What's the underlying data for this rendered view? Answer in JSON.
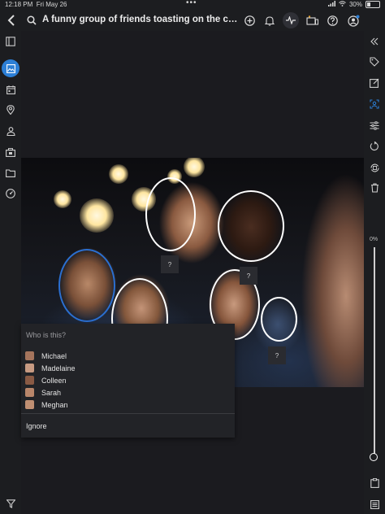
{
  "status": {
    "time": "12:18 PM",
    "date": "Fri May 26",
    "battery": "30%"
  },
  "header": {
    "title": "A funny group of friends toasting on the country v..."
  },
  "popup": {
    "prompt": "Who is this?",
    "people": [
      {
        "name": "Michael",
        "color": "#a5745c"
      },
      {
        "name": "Madelaine",
        "color": "#c79a82"
      },
      {
        "name": "Colleen",
        "color": "#8a5a44"
      },
      {
        "name": "Sarah",
        "color": "#b9866a"
      },
      {
        "name": "Meghan",
        "color": "#c08f72"
      }
    ],
    "ignore_label": "Ignore"
  },
  "photo": {
    "unknown_face_label": "?"
  },
  "zoom": {
    "level": "0%"
  },
  "colors": {
    "accent": "#2c7fd6",
    "background": "#1c1d20"
  }
}
